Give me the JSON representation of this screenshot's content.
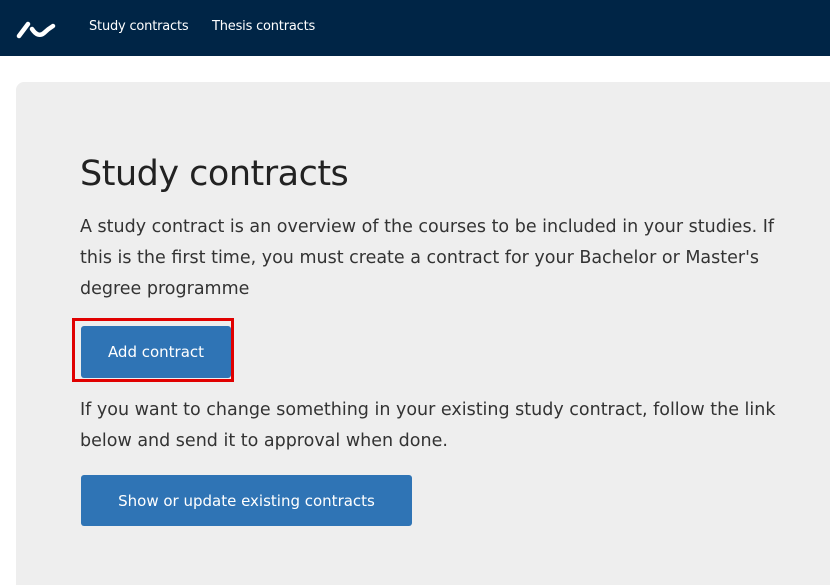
{
  "header": {
    "nav": [
      {
        "label": "Study contracts"
      },
      {
        "label": "Thesis contracts"
      }
    ],
    "logo_icon": "au-wave-logo-icon",
    "background_color": "#002546"
  },
  "main": {
    "title": "Study contracts",
    "intro": "A study contract is an overview of the courses to be included in your studies. If this is the first time, you must create a contract for your Bachelor or Master's degree programme",
    "add_button_label": "Add contract",
    "change_text": "If you want to change something in your existing study contract, follow the link below and send it to approval when done.",
    "show_button_label": "Show or update existing contracts",
    "button_color": "#2f74b5",
    "highlight_color": "#e00000",
    "panel_color": "#eeeeee"
  }
}
